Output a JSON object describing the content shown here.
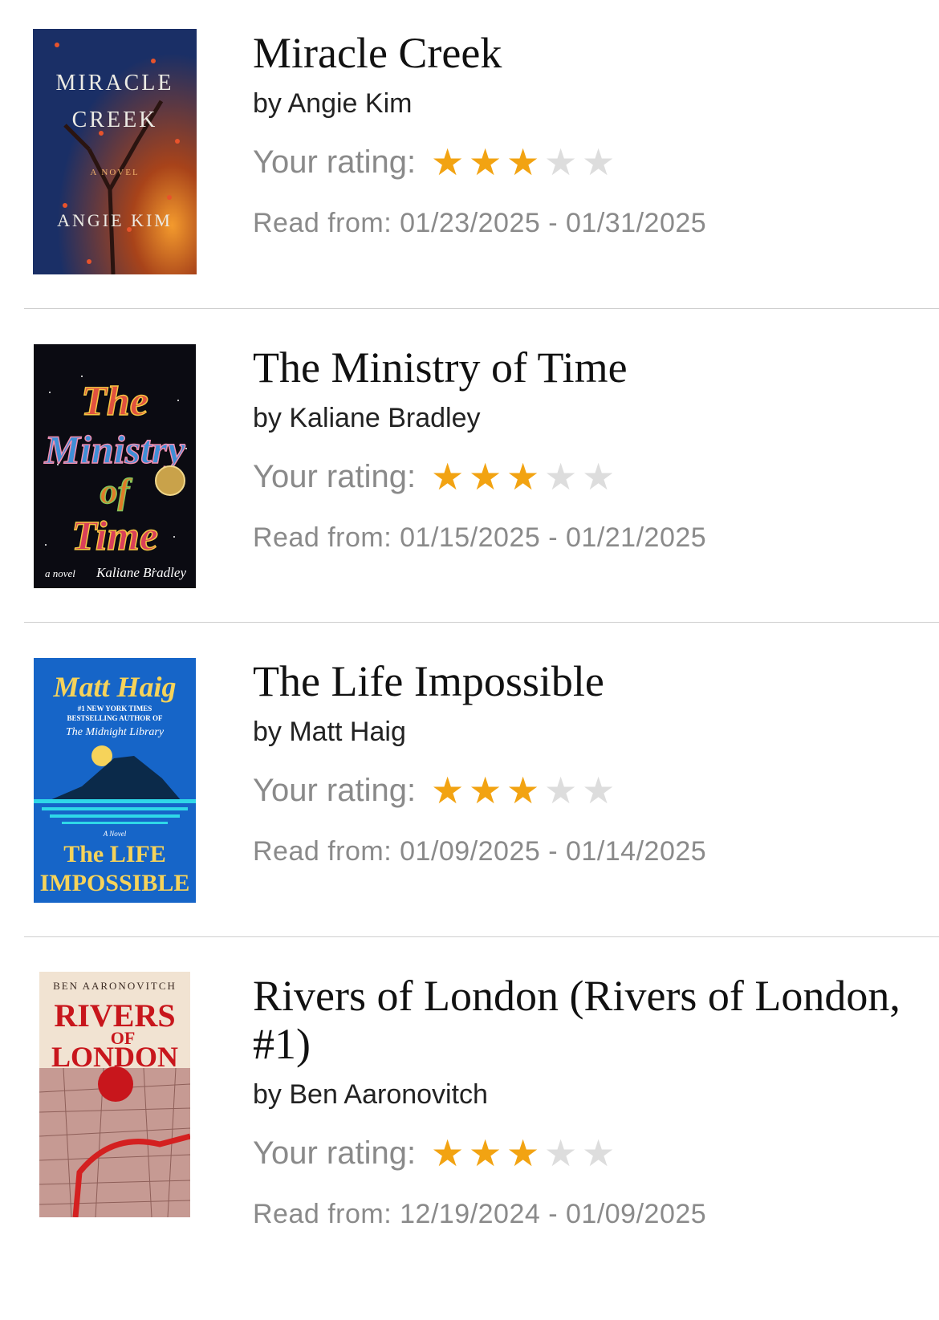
{
  "rating_label": "Your rating:",
  "colors": {
    "star_on": "#f2a312",
    "star_off": "#dddddd"
  },
  "books": [
    {
      "title": "Miracle Creek",
      "author": "by Angie Kim",
      "rating": 3,
      "max_rating": 5,
      "dates": "Read from: 01/23/2025 - 01/31/2025",
      "cover": {
        "line1": "MIRACLE",
        "line2": "CREEK",
        "sub": "A NOVEL",
        "author": "ANGIE KIM"
      }
    },
    {
      "title": "The Ministry of Time",
      "author": "by Kaliane Bradley",
      "rating": 3,
      "max_rating": 5,
      "dates": "Read from: 01/15/2025 - 01/21/2025",
      "cover": {
        "w1": "The",
        "w2": "Ministry",
        "w3": "of",
        "w4": "Time",
        "sub": "a novel",
        "author": "Kaliane Bradley"
      }
    },
    {
      "title": "The Life Impossible",
      "author": "by Matt Haig",
      "rating": 3,
      "max_rating": 5,
      "dates": "Read from: 01/09/2025 - 01/14/2025",
      "cover": {
        "author": "Matt Haig",
        "tag1": "#1 NEW YORK TIMES",
        "tag2": "BESTSELLING AUTHOR OF",
        "tag3": "The Midnight Library",
        "sub": "A Novel",
        "title1": "The LIFE",
        "title2": "IMPOSSIBLE"
      }
    },
    {
      "title": "Rivers of London (Rivers of London, #1)",
      "author": "by Ben Aaronovitch",
      "rating": 3,
      "max_rating": 5,
      "dates": "Read from: 12/19/2024 - 01/09/2025",
      "cover": {
        "author": "BEN AARONOVITCH",
        "w1": "RIVERS",
        "w2": "OF",
        "w3": "LONDON"
      }
    }
  ]
}
